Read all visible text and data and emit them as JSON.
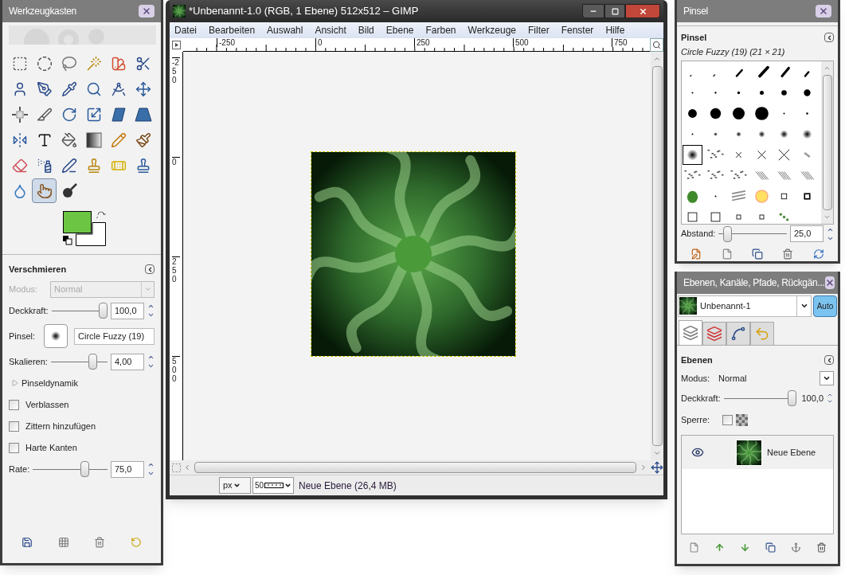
{
  "toolbox": {
    "title": "Werkzeugkasten",
    "tools": [
      {
        "selected": false
      },
      {
        "selected": false
      },
      {
        "selected": false
      },
      {
        "selected": false
      },
      {
        "selected": false
      },
      {
        "selected": false
      },
      {
        "selected": false
      },
      {
        "selected": false
      },
      {
        "selected": false
      },
      {
        "selected": false
      },
      {
        "selected": false
      },
      {
        "selected": false
      },
      {
        "selected": false
      },
      {
        "selected": false
      },
      {
        "selected": false
      },
      {
        "selected": false
      },
      {
        "selected": false
      },
      {
        "selected": false
      },
      {
        "selected": false
      },
      {
        "selected": false
      },
      {
        "selected": false
      },
      {
        "selected": false
      },
      {
        "selected": false
      },
      {
        "selected": false
      },
      {
        "selected": false
      },
      {
        "selected": false
      },
      {
        "selected": false
      },
      {
        "selected": false
      },
      {
        "selected": false
      },
      {
        "selected": false
      },
      {
        "selected": false
      },
      {
        "selected": true
      },
      {
        "selected": false
      }
    ],
    "colors": [
      {
        "color": "#6cc644"
      },
      {
        "color": "#ffffff"
      }
    ]
  },
  "tool_options": {
    "title": "Verschmieren",
    "mode": {
      "label": "Modus:",
      "value": "Normal",
      "disabled": true
    },
    "opacity": {
      "label": "Deckkraft:",
      "level": 1,
      "value": "100,0"
    },
    "brush": {
      "label": "Pinsel:",
      "value": "Circle Fuzzy (19)"
    },
    "scale": {
      "label": "Skalieren:",
      "level": 0.78,
      "value": "4,00"
    },
    "dynamics": {
      "label": "Pinseldynamik",
      "expanded": false
    },
    "checkboxes": [
      {
        "label": "Verblassen",
        "checked": false
      },
      {
        "label": "Zittern hinzufügen",
        "checked": false
      },
      {
        "label": "Harte Kanten",
        "checked": false
      }
    ],
    "rate": {
      "label": "Rate:",
      "level": 0.72,
      "value": "75,0"
    }
  },
  "image_window": {
    "title": "*Unbenannt-1.0 (RGB, 1 Ebene) 512x512 – GIMP",
    "menu": [
      "Datei",
      "Bearbeiten",
      "Auswahl",
      "Ansicht",
      "Bild",
      "Ebene",
      "Farben",
      "Werkzeuge",
      "Filter",
      "Fenster",
      "Hilfe"
    ],
    "hruler": [
      "-250",
      "0",
      "250",
      "500",
      "750"
    ],
    "vruler": [
      "-250",
      "0",
      "250",
      "500"
    ],
    "status": {
      "unit": "px",
      "zoom": "50",
      "message": "Neue Ebene (26,4 MB)"
    }
  },
  "brushes": {
    "title": "Pinsel",
    "heading": "Pinsel",
    "current": "Circle Fuzzy (19) (21 × 21)",
    "items": [
      {
        "selected": false
      },
      {
        "selected": false
      },
      {
        "selected": false
      },
      {
        "selected": false
      },
      {
        "selected": false
      },
      {
        "selected": false
      },
      {
        "selected": false
      },
      {
        "selected": false
      },
      {
        "selected": false
      },
      {
        "selected": false
      },
      {
        "selected": false
      },
      {
        "selected": false
      },
      {
        "selected": false
      },
      {
        "selected": false
      },
      {
        "selected": false
      },
      {
        "selected": false
      },
      {
        "selected": false
      },
      {
        "selected": false
      },
      {
        "selected": false
      },
      {
        "selected": false
      },
      {
        "selected": false
      },
      {
        "selected": false
      },
      {
        "selected": false
      },
      {
        "selected": false
      },
      {
        "selected": true
      },
      {
        "selected": false
      },
      {
        "selected": false
      },
      {
        "selected": false
      },
      {
        "selected": false
      },
      {
        "selected": false
      },
      {
        "selected": false
      },
      {
        "selected": false
      },
      {
        "selected": false
      },
      {
        "selected": false
      },
      {
        "selected": false
      },
      {
        "selected": false
      },
      {
        "selected": false
      },
      {
        "selected": false
      },
      {
        "selected": false
      },
      {
        "selected": false
      },
      {
        "selected": false
      },
      {
        "selected": false
      },
      {
        "selected": false
      },
      {
        "selected": false
      },
      {
        "selected": false
      },
      {
        "selected": false
      },
      {
        "selected": false
      }
    ],
    "spacing": {
      "label": "Abstand:",
      "level": 0.08,
      "value": "25,0"
    }
  },
  "layers": {
    "title": "Ebenen, Kanäle, Pfade, Rückgän...",
    "image": "Unbenannt-1",
    "auto": {
      "label": "Auto",
      "on": true
    },
    "tabs": [
      {
        "selected": true
      },
      {
        "selected": false
      },
      {
        "selected": false
      },
      {
        "selected": false
      }
    ],
    "heading": "Ebenen",
    "mode": {
      "label": "Modus:",
      "value": "Normal"
    },
    "opacity": {
      "label": "Deckkraft:",
      "level": 1,
      "value": "100,0"
    },
    "lock": {
      "label": "Sperre:",
      "checked": false
    },
    "items": [
      {
        "name": "Neue Ebene",
        "visible": true,
        "selected": false
      }
    ]
  }
}
